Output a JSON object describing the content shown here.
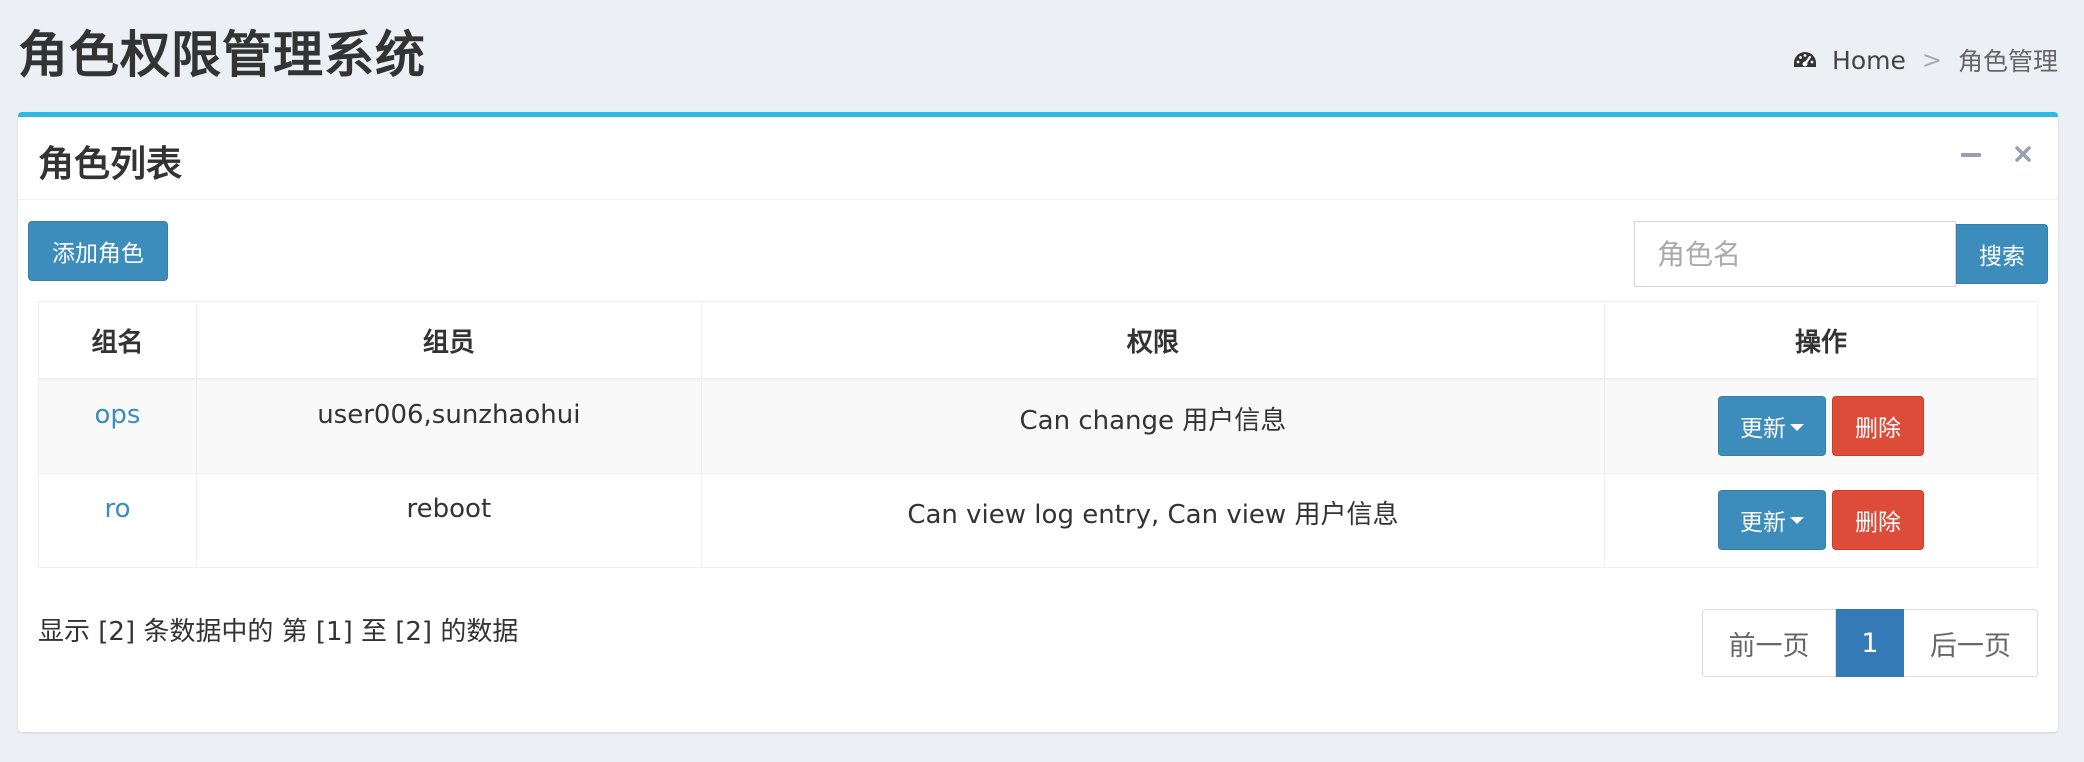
{
  "header": {
    "title": "角色权限管理系统",
    "breadcrumb": {
      "home_icon": "dashboard-icon",
      "home_label": "Home",
      "separator": ">",
      "current": "角色管理"
    }
  },
  "box": {
    "title": "角色列表",
    "tools": {
      "collapse_icon": "minus-icon",
      "remove_icon": "close-icon"
    },
    "accent_color": "#2fb8e0"
  },
  "toolbar": {
    "add_label": "添加角色",
    "search_placeholder": "角色名",
    "search_value": "",
    "search_label": "搜索"
  },
  "table": {
    "columns": [
      "组名",
      "组员",
      "权限",
      "操作"
    ],
    "rows": [
      {
        "name": "ops",
        "members": "user006,sunzhaohui",
        "permissions": "Can change 用户信息",
        "update_label": "更新",
        "delete_label": "删除"
      },
      {
        "name": "ro",
        "members": "reboot",
        "permissions": "Can view log entry, Can view 用户信息",
        "update_label": "更新",
        "delete_label": "删除"
      }
    ]
  },
  "footer": {
    "info": "显示 [2] 条数据中的 第 [1] 至 [2] 的数据",
    "pagination": {
      "prev_label": "前一页",
      "current_page": "1",
      "next_label": "后一页"
    }
  },
  "colors": {
    "primary": "#3c8dbc",
    "danger": "#dd4b39",
    "page_active": "#337ab7",
    "background": "#ecf0f5"
  }
}
